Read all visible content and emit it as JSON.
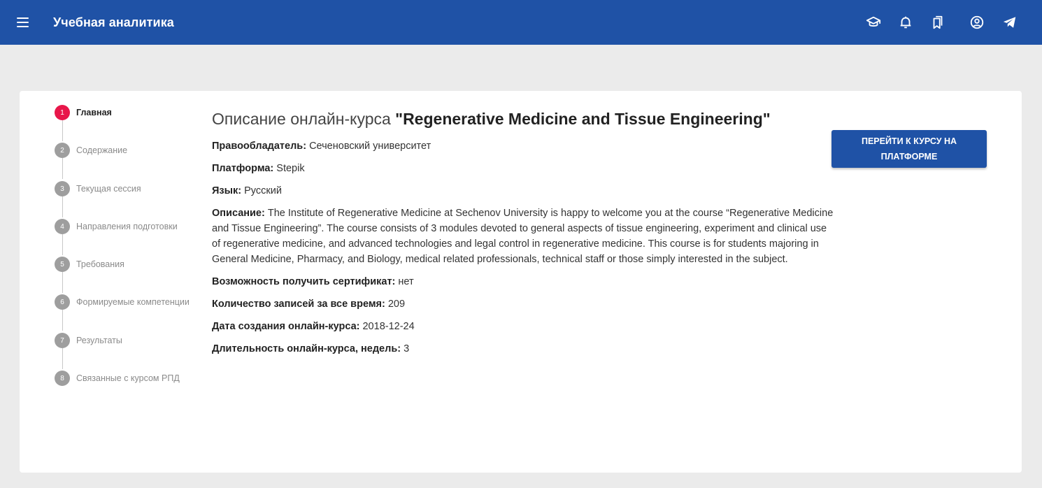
{
  "header": {
    "title": "Учебная аналитика",
    "icons": [
      "menu-icon",
      "graduation-cap-icon",
      "bell-icon",
      "bookmarks-icon",
      "account-icon",
      "telegram-icon"
    ],
    "background": "#1f52a6"
  },
  "stepper": {
    "steps": [
      {
        "num": "1",
        "label": "Главная"
      },
      {
        "num": "2",
        "label": "Содержание"
      },
      {
        "num": "3",
        "label": "Текущая сессия"
      },
      {
        "num": "4",
        "label": "Направления подготовки"
      },
      {
        "num": "5",
        "label": "Требования"
      },
      {
        "num": "6",
        "label": "Формируемые компетенции"
      },
      {
        "num": "7",
        "label": "Результаты"
      },
      {
        "num": "8",
        "label": "Связанные с курсом РПД"
      }
    ],
    "active_index": 0,
    "active_color": "#e8174a"
  },
  "course": {
    "title_prefix": "Описание онлайн-курса ",
    "title_name": "\"Regenerative Medicine and Tissue Engineering\"",
    "fields": [
      {
        "key": "Правообладатель:",
        "value": " Сеченовский университет"
      },
      {
        "key": "Платформа:",
        "value": " Stepik"
      },
      {
        "key": "Язык:",
        "value": " Русский"
      },
      {
        "key": "Описание:",
        "value": " The Institute of Regenerative Medicine at Sechenov University is happy to welcome you at the course “Regenerative Medicine and Tissue Engineering”. The course consists of 3 modules devoted to general aspects of tissue engineering, experiment and clinical use of regenerative medicine, and advanced technologies and legal control in regenerative medicine. This course is for students majoring in General Medicine, Pharmacy, and Biology, medical related professionals, technical staff or those simply interested in the subject."
      },
      {
        "key": "Возможность получить сертификат:",
        "value": " нет"
      },
      {
        "key": "Количество записей за все время:",
        "value": " 209"
      },
      {
        "key": "Дата создания онлайн-курса:",
        "value": " 2018-12-24"
      },
      {
        "key": "Длительность онлайн-курса, недель:",
        "value": " 3"
      }
    ],
    "go_button_label": "ПЕРЕЙТИ К КУРСУ НА ПЛАТФОРМЕ"
  }
}
